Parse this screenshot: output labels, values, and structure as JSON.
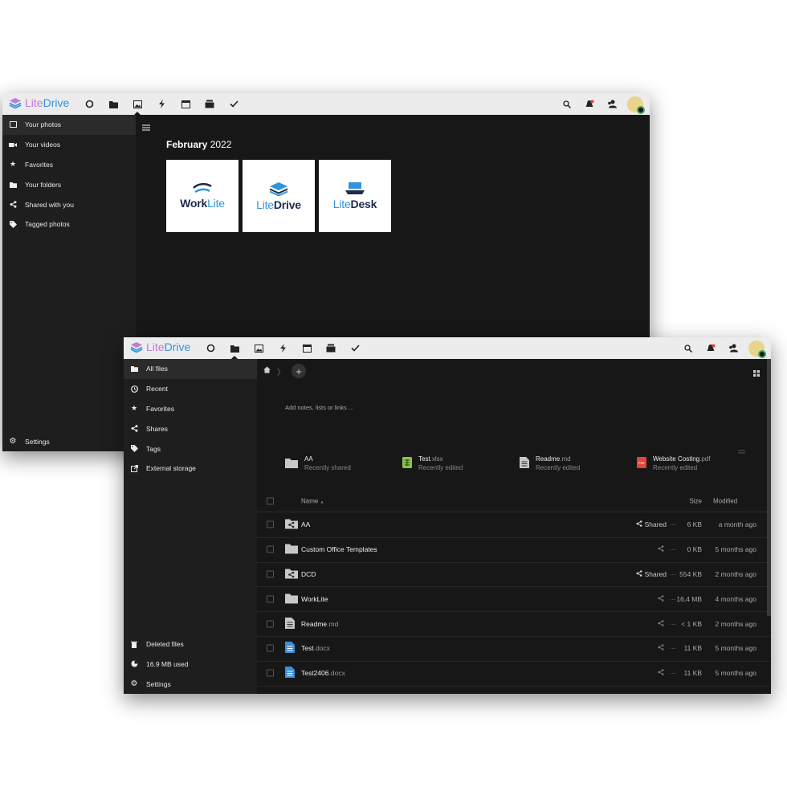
{
  "brand": {
    "part1": "Lite",
    "part2": "Drive"
  },
  "photos_window": {
    "sidebar": [
      {
        "label": "Your photos",
        "icon": "image-icon",
        "active": true
      },
      {
        "label": "Your videos",
        "icon": "video-icon"
      },
      {
        "label": "Favorites",
        "icon": "star-icon"
      },
      {
        "label": "Your folders",
        "icon": "folder-icon"
      },
      {
        "label": "Shared with you",
        "icon": "share-icon"
      },
      {
        "label": "Tagged photos",
        "icon": "tag-icon"
      }
    ],
    "settings_label": "Settings",
    "month": {
      "name": "February",
      "year": "2022"
    },
    "thumbs": [
      {
        "part1": "Work",
        "part2": "Lite",
        "color1": "#1e2a4a",
        "color2": "#2f94e0"
      },
      {
        "part1": "Lite",
        "part2": "Drive",
        "color1": "#2f94e0",
        "color2": "#1e2a4a"
      },
      {
        "part1": "Lite",
        "part2": "Desk",
        "color1": "#2f94e0",
        "color2": "#1e2a4a"
      }
    ]
  },
  "files_window": {
    "sidebar": [
      {
        "label": "All files",
        "icon": "folder-icon",
        "active": true
      },
      {
        "label": "Recent",
        "icon": "clock-icon"
      },
      {
        "label": "Favorites",
        "icon": "star-icon"
      },
      {
        "label": "Shares",
        "icon": "share-icon"
      },
      {
        "label": "Tags",
        "icon": "tag-icon"
      },
      {
        "label": "External storage",
        "icon": "external-icon"
      }
    ],
    "sidebar_bottom": [
      {
        "label": "Deleted files",
        "icon": "trash-icon"
      },
      {
        "label": "16.9 MB used",
        "icon": "pie-icon"
      },
      {
        "label": "Settings",
        "icon": "gear-icon"
      }
    ],
    "notes_placeholder": "Add notes, lists or links …",
    "recents": [
      {
        "name": "AA",
        "ext": "",
        "sub": "Recently shared",
        "icon": "folder-icon"
      },
      {
        "name": "Test",
        "ext": ".xlsx",
        "sub": "Recently edited",
        "icon": "spreadsheet-icon"
      },
      {
        "name": "Readme",
        "ext": ".md",
        "sub": "Recently edited",
        "icon": "text-file-icon"
      },
      {
        "name": "Website Costing",
        "ext": ".pdf",
        "sub": "Recently edited",
        "icon": "pdf-icon"
      }
    ],
    "columns": {
      "name": "Name",
      "sort": "▲",
      "size": "Size",
      "modified": "Modified"
    },
    "files": [
      {
        "name": "AA",
        "ext": "",
        "type": "shared-folder",
        "shared": true,
        "share_label": "Shared",
        "size": "6 KB",
        "modified": "a month ago"
      },
      {
        "name": "Custom Office Templates",
        "ext": "",
        "type": "folder",
        "shared": false,
        "share_label": "",
        "size": "0 KB",
        "modified": "5 months ago"
      },
      {
        "name": "DCD",
        "ext": "",
        "type": "shared-folder",
        "shared": true,
        "share_label": "Shared",
        "size": "554 KB",
        "modified": "2 months ago"
      },
      {
        "name": "WorkLite",
        "ext": "",
        "type": "folder",
        "shared": false,
        "share_label": "",
        "size": "16,4 MB",
        "modified": "4 months ago"
      },
      {
        "name": "Readme",
        "ext": ".md",
        "type": "text",
        "shared": false,
        "share_label": "",
        "size": "< 1 KB",
        "modified": "2 months ago"
      },
      {
        "name": "Test",
        "ext": ".docx",
        "type": "doc",
        "shared": false,
        "share_label": "",
        "size": "11 KB",
        "modified": "5 months ago"
      },
      {
        "name": "Test2406",
        "ext": ".docx",
        "type": "doc",
        "shared": false,
        "share_label": "",
        "size": "11 KB",
        "modified": "5 months ago"
      }
    ],
    "more_label": "···"
  },
  "colors": {
    "accent_blue": "#2f94e0",
    "accent_purple": "#c27bd6",
    "status_green": "#3fa55b",
    "pdf_red": "#e0463a",
    "sheet_green": "#8bc34a"
  }
}
